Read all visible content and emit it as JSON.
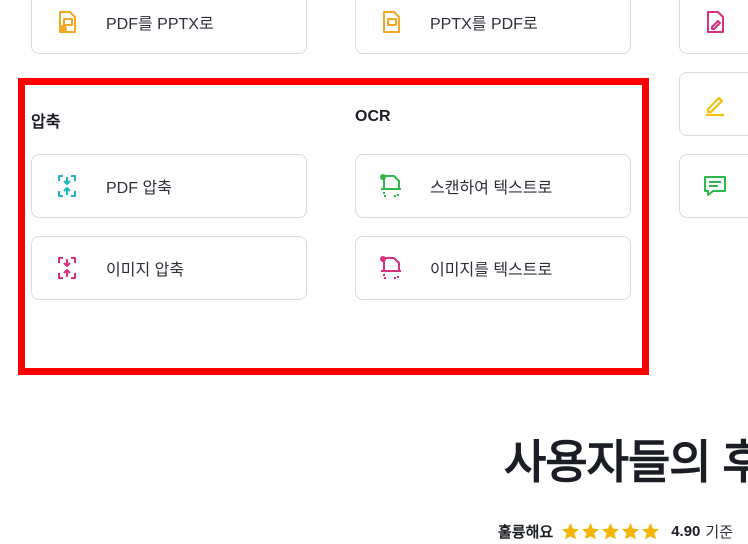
{
  "top_row": {
    "pdf_to_pptx": "PDF를 PPTX로",
    "pptx_to_pdf": "PPTX를 PDF로"
  },
  "compress": {
    "heading": "압축",
    "items": [
      {
        "label": "PDF 압축",
        "icon": "compress-pdf-icon"
      },
      {
        "label": "이미지 압축",
        "icon": "compress-image-icon"
      }
    ]
  },
  "ocr": {
    "heading": "OCR",
    "items": [
      {
        "label": "스캔하여 텍스트로",
        "icon": "scan-to-text-icon"
      },
      {
        "label": "이미지를 텍스트로",
        "icon": "image-to-text-icon"
      }
    ]
  },
  "reviews": {
    "title": "사용자들의 후",
    "rating_word": "훌륭해요",
    "score": "4.90",
    "basis": "기준",
    "stars": 5
  },
  "colors": {
    "orange": "#f5a623",
    "pink": "#d6307f",
    "teal": "#1fb5c4",
    "green": "#2fb84a",
    "yellow": "#f4c20d",
    "highlight": "#ff0000",
    "star": "#f5b400"
  }
}
